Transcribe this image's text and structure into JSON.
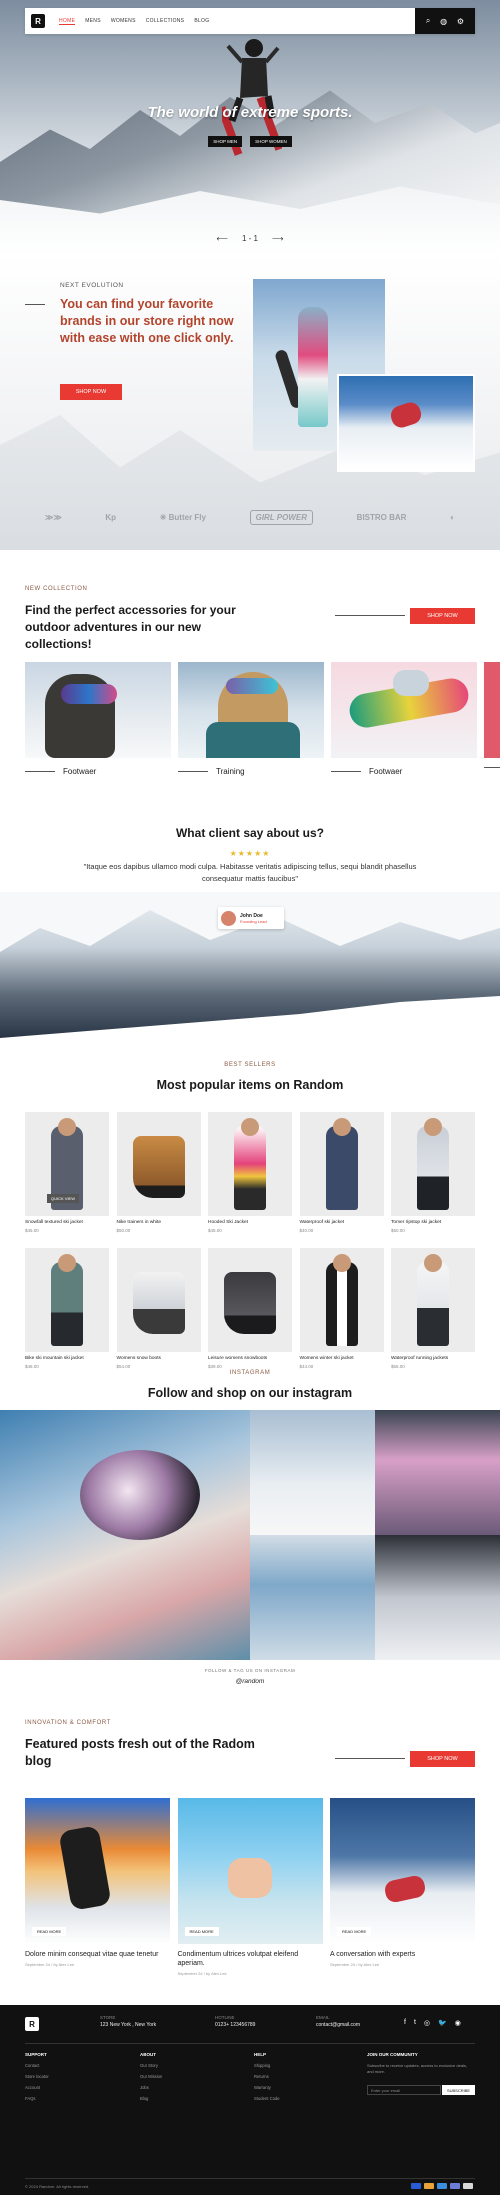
{
  "nav": {
    "logo": "R",
    "menu": [
      "HOME",
      "MENS",
      "WOMENS",
      "COLLECTIONS",
      "BLOG"
    ],
    "icons": [
      "search-icon",
      "user-icon",
      "gear-icon"
    ]
  },
  "hero": {
    "title": "The world of extreme sports.",
    "btn_men": "SHOP MEN",
    "btn_women": "SHOP WOMEN",
    "pager": "1 - 1",
    "prev": "⟵",
    "next": "⟶"
  },
  "about": {
    "kicker": "NEXT EVOLUTION",
    "text": "You can find your favorite brands in our store right now with ease with one click only.",
    "button": "SHOP NOW",
    "brands": [
      "≫≫",
      "Kp",
      "✳ Butter Fly",
      "GIRL POWER",
      "BISTRO BAR",
      "◐"
    ]
  },
  "collection": {
    "kicker": "NEW COLLECTION",
    "title": "Find the perfect accessories for your outdoor adventures in our new collections!",
    "button": "SHOP NOW",
    "cards": [
      "Footwaer",
      "Training",
      "Footwaer"
    ]
  },
  "testimonial": {
    "title": "What client say about us?",
    "stars": "★★★★★",
    "quote": "\"Itaque eos dapibus ullamco modi culpa. Habitasse veritatis adipiscing tellus, sequi blandit phasellus consequatur mattis faucibus\"",
    "name": "John Doe",
    "role": "Founding Lead"
  },
  "bestsellers": {
    "kicker": "BEST SELLERS",
    "title": "Most popular items on Random",
    "quick_view": "QUICK VIEW",
    "products": [
      {
        "name": "Snowfall textured ski jacket",
        "price": "$45.00"
      },
      {
        "name": "Nike trainers in white",
        "price": "$50.00"
      },
      {
        "name": "Hooded Ski Jacket",
        "price": "$45.00"
      },
      {
        "name": "Waterproof ski jacket",
        "price": "$40.00"
      },
      {
        "name": "Tomer ripstop ski jacket",
        "price": "$50.00"
      },
      {
        "name": "Bike ski mountain ski jacket",
        "price": "$48.00"
      },
      {
        "name": "Womens snow boots",
        "price": "$54.00"
      },
      {
        "name": "Leisure womens snowboots",
        "price": "$39.00"
      },
      {
        "name": "Womens winter ski jacket",
        "price": "$44.00"
      },
      {
        "name": "Waterproof running jackets",
        "price": "$55.00"
      }
    ]
  },
  "instagram": {
    "kicker": "INSTAGRAM",
    "title": "Follow and shop on our instagram",
    "follow": "FOLLOW & TAG US ON INSTAGRAM",
    "handle": "@random"
  },
  "blog": {
    "kicker": "INNOVATION & COMFORT",
    "title": "Featured posts fresh out of the Radom blog",
    "button": "SHOP NOW",
    "read_more": "READ MORE",
    "posts": [
      {
        "title": "Dolore minim consequat vitae quae tenetur",
        "meta": "September 24 / by Alex Lee"
      },
      {
        "title": "Condimentum ultrices volutpat eleifend aperiam.",
        "meta": "September 24 / by Alex Lee"
      },
      {
        "title": "A conversation with experts",
        "meta": "September 24 / by Alex Lee"
      }
    ]
  },
  "footer": {
    "logo": "R",
    "store_label": "STORE",
    "store": "123 New York , New York",
    "hotline_label": "HOTLINE",
    "hotline": "0123+ 123456789",
    "email_label": "EMAIL",
    "email": "contact@gmail.com",
    "social": [
      "f",
      "t",
      "◎",
      "🐦",
      "◉"
    ],
    "cols": [
      {
        "heading": "SUPPORT",
        "items": [
          "Contact",
          "Store locator",
          "Account",
          "FAQs"
        ]
      },
      {
        "heading": "ABOUT",
        "items": [
          "Our Story",
          "Our Mission",
          "Jobs",
          "Blog"
        ]
      },
      {
        "heading": "HELP",
        "items": [
          "Shipping",
          "Returns",
          "Warranty",
          "Student Code"
        ]
      }
    ],
    "news_heading": "JOIN OUR COMMUNITY",
    "news_text": "Subscribe to receive updates, access to exclusive deals, and more.",
    "email_placeholder": "Enter your email",
    "subscribe": "SUBSCRIBE",
    "copyright": "© 2024 Random. All rights reserved."
  },
  "colors": {
    "accent": "#e83a33",
    "headline_brown": "#b2442c",
    "footer_bg": "#111111"
  }
}
